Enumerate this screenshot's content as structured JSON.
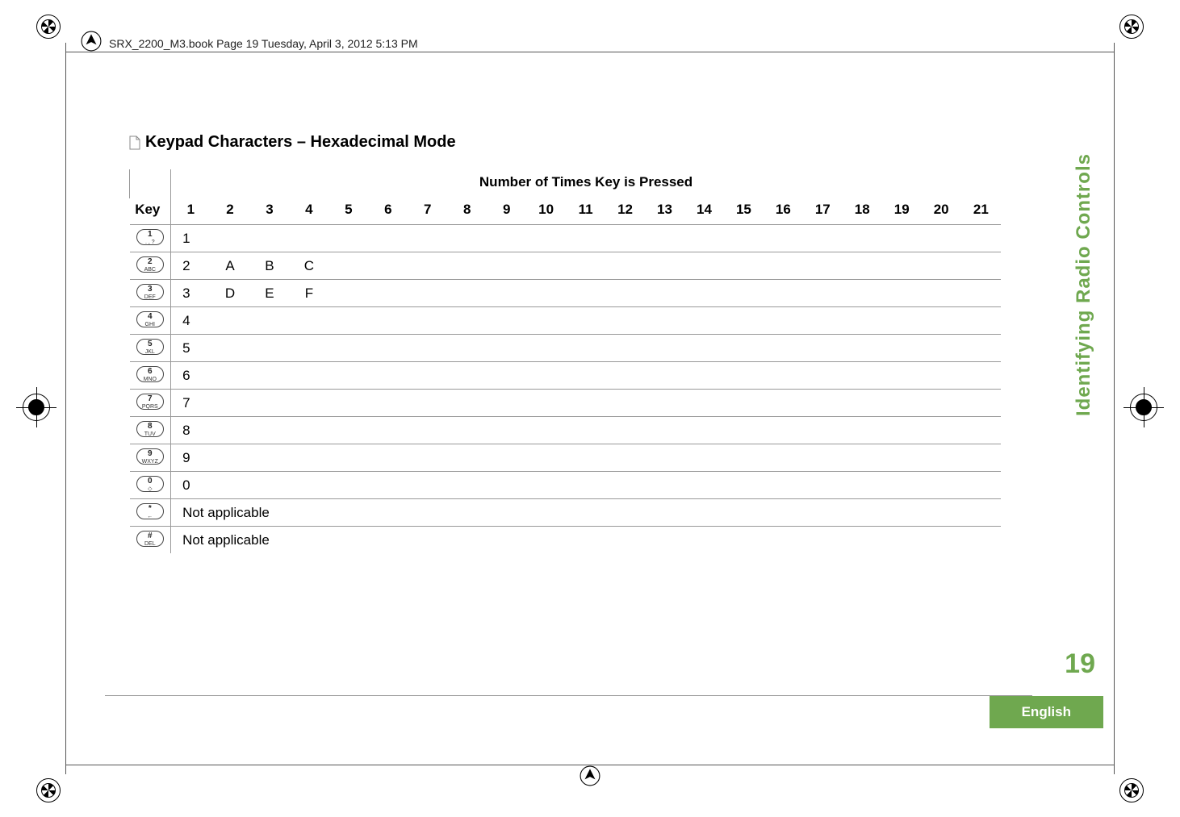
{
  "running_header": "SRX_2200_M3.book  Page 19  Tuesday, April 3, 2012  5:13 PM",
  "section_title": "Keypad Characters – Hexadecimal Mode",
  "table": {
    "overhead": "Number of Times Key is Pressed",
    "key_header": "Key",
    "col_nums": [
      "1",
      "2",
      "3",
      "4",
      "5",
      "6",
      "7",
      "8",
      "9",
      "10",
      "11",
      "12",
      "13",
      "14",
      "15",
      "16",
      "17",
      "18",
      "19",
      "20",
      "21"
    ],
    "rows": [
      {
        "key_big": "1",
        "key_sub": ". , ?",
        "values": [
          "1"
        ]
      },
      {
        "key_big": "2",
        "key_sub": "ABC",
        "values": [
          "2",
          "A",
          "B",
          "C"
        ]
      },
      {
        "key_big": "3",
        "key_sub": "DEF",
        "values": [
          "3",
          "D",
          "E",
          "F"
        ]
      },
      {
        "key_big": "4",
        "key_sub": "GHI",
        "values": [
          "4"
        ]
      },
      {
        "key_big": "5",
        "key_sub": "JKL",
        "values": [
          "5"
        ]
      },
      {
        "key_big": "6",
        "key_sub": "MNO",
        "values": [
          "6"
        ]
      },
      {
        "key_big": "7",
        "key_sub": "PQRS",
        "values": [
          "7"
        ]
      },
      {
        "key_big": "8",
        "key_sub": "TUV",
        "values": [
          "8"
        ]
      },
      {
        "key_big": "9",
        "key_sub": "WXYZ",
        "values": [
          "9"
        ]
      },
      {
        "key_big": "0",
        "key_sub": "◇",
        "values": [
          "0"
        ]
      },
      {
        "key_big": "*",
        "key_sub": "←",
        "span_text": "Not applicable"
      },
      {
        "key_big": "#",
        "key_sub": "DEL",
        "span_text": "Not applicable"
      }
    ]
  },
  "sidebar_title": "Identifying Radio Controls",
  "page_number": "19",
  "language_label": "English"
}
